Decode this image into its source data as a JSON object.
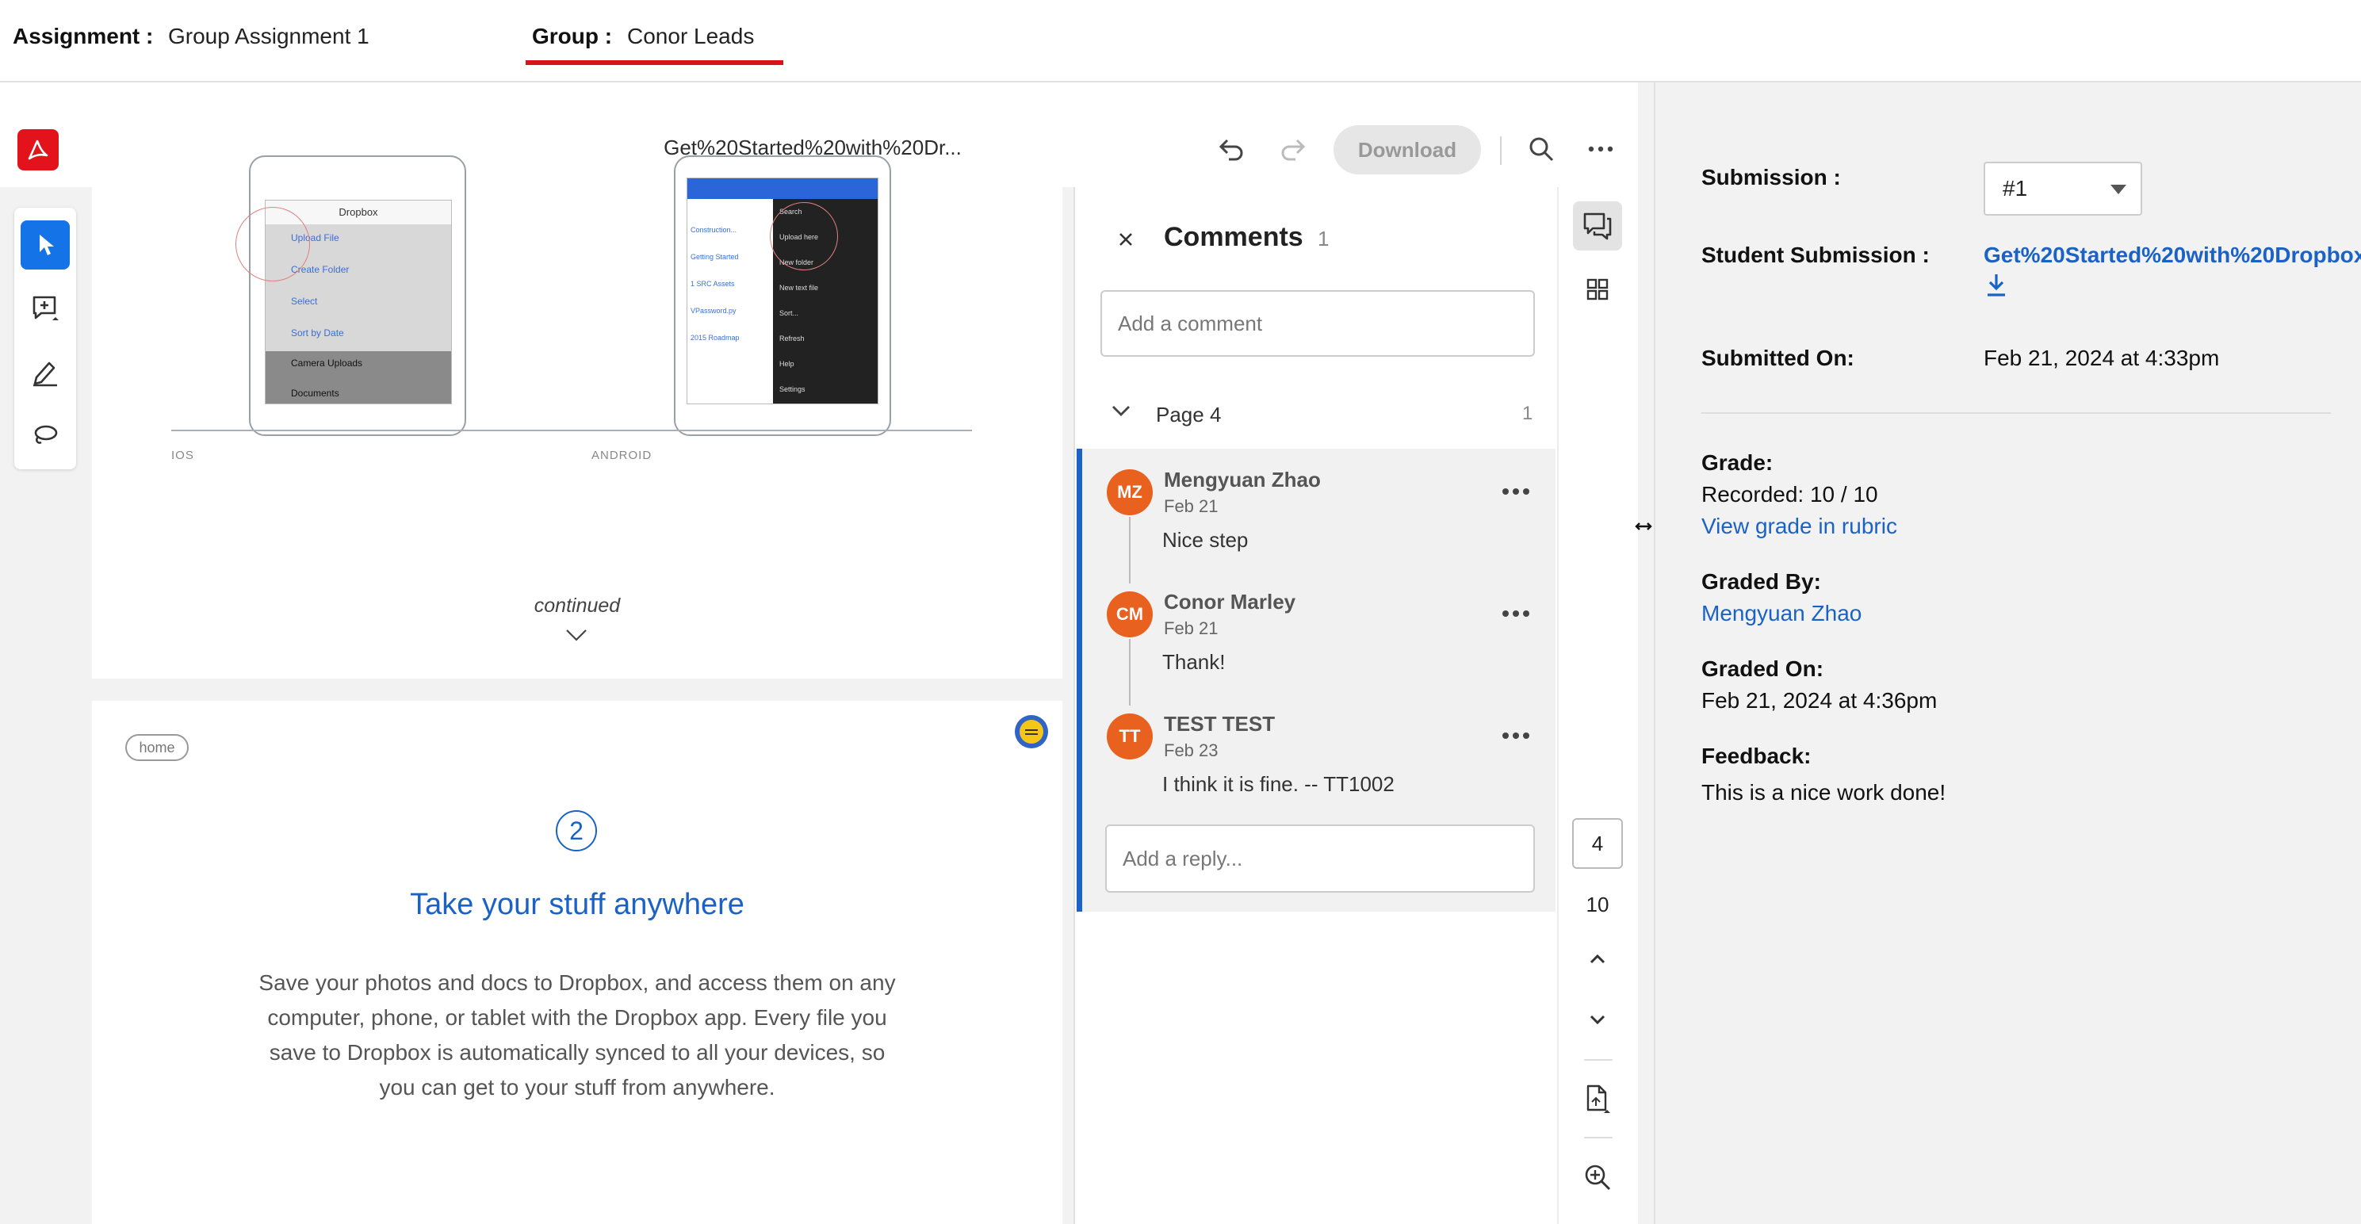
{
  "header": {
    "assignment_label": "Assignment :",
    "assignment_value": "Group Assignment 1",
    "group_label": "Group :",
    "group_value": "Conor Leads"
  },
  "viewer": {
    "doc_title": "Get%20Started%20with%20Dr...",
    "download_label": "Download",
    "icons": [
      "acrobat-logo",
      "undo-icon",
      "redo-icon",
      "search-icon",
      "more-icon"
    ]
  },
  "tools": [
    "select-tool",
    "add-comment-tool",
    "highlight-tool",
    "lasso-tool"
  ],
  "page1": {
    "ios_caption": "IOS",
    "android_caption": "ANDROID",
    "ios_menu": {
      "title": "Dropbox",
      "items": [
        "Upload File",
        "Create Folder",
        "Select",
        "Sort by Date"
      ],
      "dark_items": [
        "Camera Uploads",
        "Documents"
      ]
    },
    "android_menu": {
      "items": [
        "Search",
        "Upload here",
        "New folder",
        "New text file",
        "Sort...",
        "Refresh",
        "Help",
        "Settings"
      ],
      "files": [
        "Construction...",
        "Getting Started",
        "1 SRC Assets",
        "VPassword.py",
        "2015 Roadmap"
      ]
    },
    "continued": "continued"
  },
  "page2": {
    "tag": "home",
    "step": "2",
    "title": "Take your stuff anywhere",
    "body": "Save your photos and docs to Dropbox, and access them on any computer, phone, or tablet with the Dropbox app. Every file you save to Dropbox is automatically synced to all your devices, so you can get to your stuff from anywhere."
  },
  "comments": {
    "title": "Comments",
    "count": "1",
    "add_placeholder": "Add a comment",
    "page_label": "Page 4",
    "page_count": "1",
    "reply_placeholder": "Add a reply...",
    "thread": [
      {
        "initials": "MZ",
        "name": "Mengyuan Zhao",
        "date": "Feb 21",
        "text": "Nice step"
      },
      {
        "initials": "CM",
        "name": "Conor Marley",
        "date": "Feb 21",
        "text": "Thank!"
      },
      {
        "initials": "TT",
        "name": "TEST TEST",
        "date": "Feb 23",
        "text": "I think it is fine. -- TT1002"
      }
    ],
    "avatar_color": "#e8611e",
    "accent": "#1b62c6"
  },
  "nav": {
    "current_page": "4",
    "total_pages": "10"
  },
  "info": {
    "submission_label": "Submission :",
    "submission_value": "#1",
    "student_submission_label": "Student Submission :",
    "student_submission_link": "Get%20Started%20with%20Dropbox",
    "submitted_on_label": "Submitted On:",
    "submitted_on_value": "Feb 21, 2024 at 4:33pm",
    "grade_label": "Grade:",
    "grade_value": "Recorded: 10 / 10",
    "rubric_link": "View grade in rubric",
    "graded_by_label": "Graded By:",
    "graded_by_value": "Mengyuan Zhao",
    "graded_on_label": "Graded On:",
    "graded_on_value": "Feb 21, 2024 at 4:36pm",
    "feedback_label": "Feedback:",
    "feedback_value": "This is a nice work done!"
  }
}
